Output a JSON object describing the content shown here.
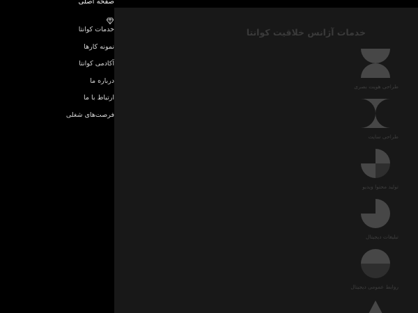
{
  "sidebar": {
    "home_label": "صفحه اصلی",
    "items": [
      {
        "label": "خدمات کوانتا"
      },
      {
        "label": "نمونه کارها"
      },
      {
        "label": "آکادمی کوانتا"
      },
      {
        "label": "درباره ما"
      },
      {
        "label": "ارتباط با ما"
      },
      {
        "label": "فرصت‌های شغلی"
      }
    ]
  },
  "main": {
    "title": "خدمات آژانس خلاقیت کوانتا",
    "services": [
      {
        "label": "طراحی هویت بصری",
        "icon": "hourglass-halves-icon"
      },
      {
        "label": "طراحی سایت",
        "icon": "bowtie-icon"
      },
      {
        "label": "تولید محتوا ویدیو",
        "icon": "quarter-pie-icon"
      },
      {
        "label": "تبلیغات دیجیتال",
        "icon": "three-quarter-pie-icon"
      },
      {
        "label": "روابط عمومی دیجیتال",
        "icon": "split-circle-icon"
      },
      {
        "label": "",
        "icon": "triangle-icon"
      }
    ]
  },
  "colors": {
    "sidebar_bg": "#000000",
    "main_bg": "#181818",
    "icon_light": "#474747",
    "icon_dark": "#2e2e2e",
    "text_light": "#d7d7d7",
    "title_text": "#3a3a3a"
  }
}
